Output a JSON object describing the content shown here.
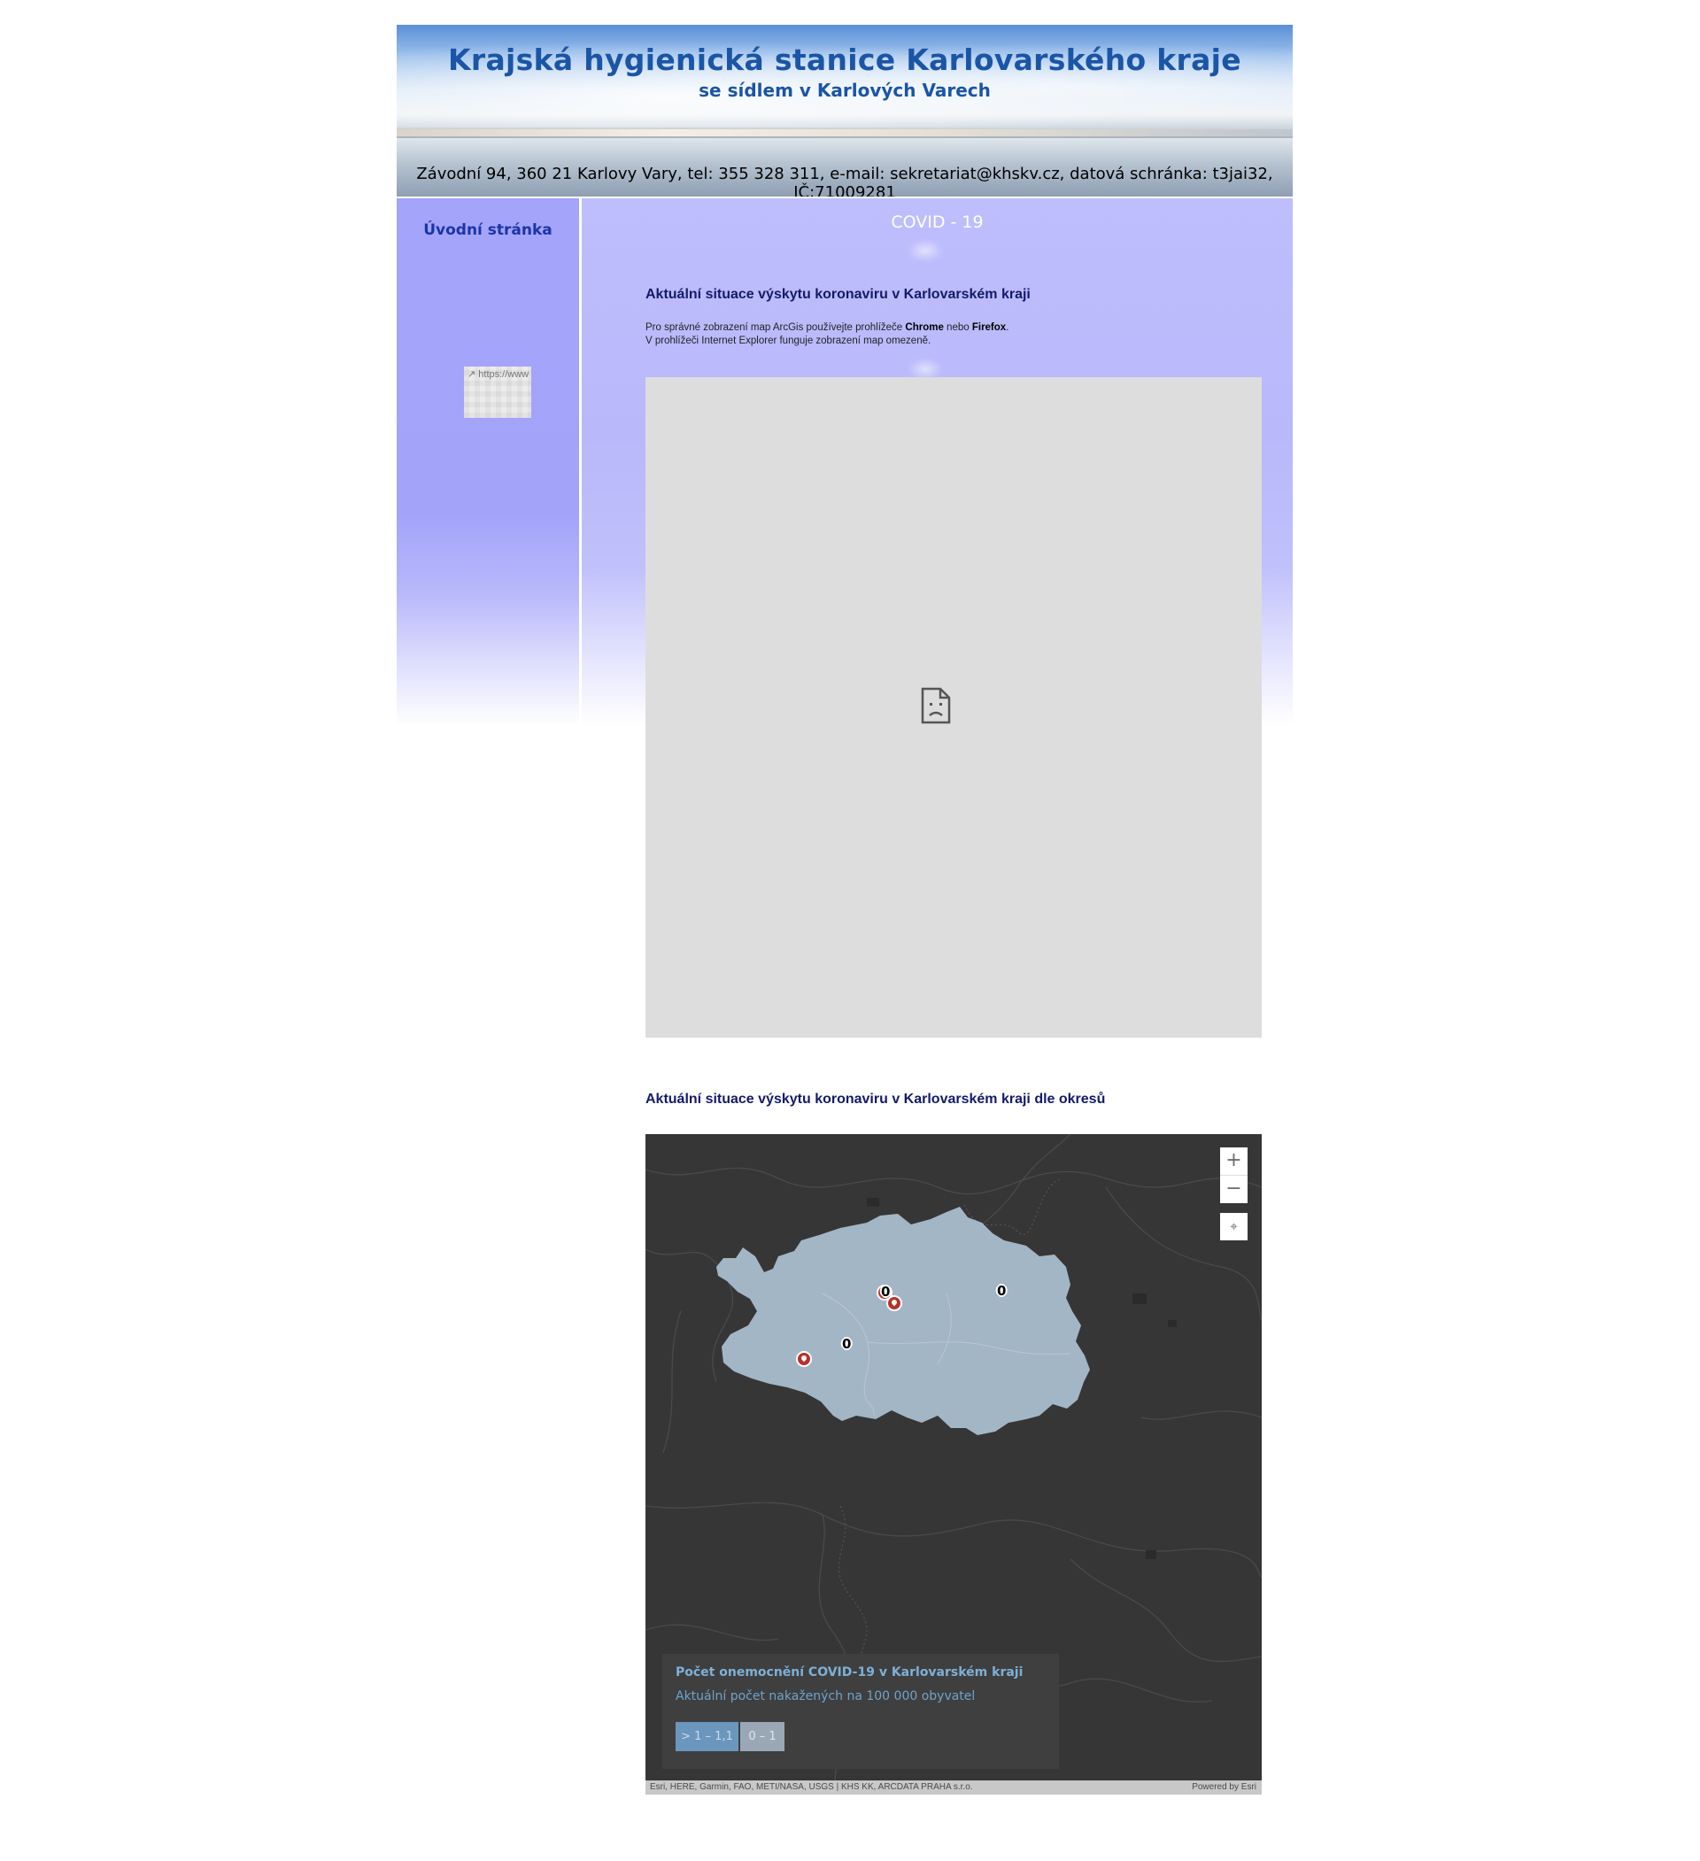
{
  "header": {
    "title": "Krajská hygienická stanice Karlovarského kraje",
    "subtitle": "se sídlem v Karlových Varech",
    "contact": "Závodní 94, 360 21 Karlovy Vary, tel: 355 328 311, e-mail: sekretariat@khskv.cz, datová schránka: t3jai32, IČ:71009281"
  },
  "sidebar": {
    "home_link": "Úvodní stránka",
    "external_link_label": "https://www"
  },
  "main": {
    "heading": "COVID - 19",
    "section1_title": "Aktuální situace výskytu koronaviru v Karlovarském kraji",
    "note_part1": "Pro správné zobrazení map ArcGis používejte prohlížeče ",
    "note_chrome": "Chrome",
    "note_part2": " nebo ",
    "note_firefox": "Firefox",
    "note_part3": ".",
    "note_line2": "V prohlížeči Internet Explorer funguje zobrazení map omezeně.",
    "section2_title": "Aktuální situace výskytu koronaviru v Karlovarském kraji dle okresů"
  },
  "map": {
    "controls": {
      "zoom_in": "+",
      "zoom_out": "−",
      "locate": "⌖"
    },
    "district_labels": [
      "0",
      "0",
      "0"
    ],
    "legend": {
      "title": "Počet onemocnění COVID-19 v Karlovarském kraji",
      "subtitle": "Aktuální počet nakažených na 100 000 obyvatel",
      "classes": [
        "> 1 – 1,1",
        "0 – 1"
      ]
    },
    "attribution": "Esri, HERE, Garmin, FAO, METI/NASA, USGS | KHS KK, ARCDATA PRAHA s.r.o.",
    "powered_by": "Powered by Esri",
    "colors": {
      "base": "#363637",
      "region": "#a3b6c5",
      "marker": "#b8322a"
    }
  }
}
